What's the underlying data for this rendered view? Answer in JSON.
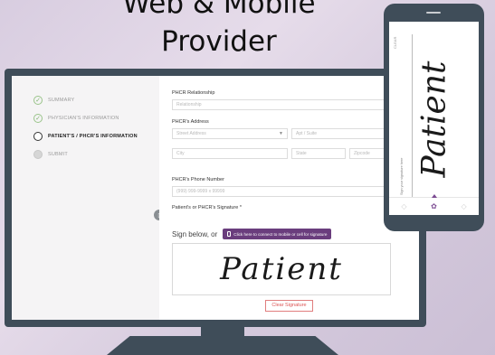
{
  "headline": {
    "line1": "Web & Mobile",
    "line2": "Provider"
  },
  "sidebar": {
    "steps": [
      {
        "label": "SUMMARY",
        "state": "done"
      },
      {
        "label": "PHYSICIAN'S INFORMATION",
        "state": "done"
      },
      {
        "label": "PATIENT'S / PHCR'S INFORMATION",
        "state": "active"
      },
      {
        "label": "SUBMIT",
        "state": "pending"
      }
    ],
    "checkmark": "✓"
  },
  "form": {
    "relationship_label": "PHCR Relationship",
    "relationship_placeholder": "Relationship",
    "address_label": "PHCR's Address",
    "street_placeholder": "Street Address",
    "apt_placeholder": "Apt / Suite",
    "city_placeholder": "City",
    "state_placeholder": "State",
    "zip_placeholder": "Zipcode",
    "phone_label": "PHCR's Phone Number",
    "phone_placeholder": "(999) 999-9999 x 99999",
    "signature_label": "Patient's or PHCR's Signature *",
    "sign_below": "Sign below, or",
    "mobile_button": "Click here to connect to mobile or cell for signature",
    "signature_value": "Patient",
    "clear_button": "Clear Signature",
    "step_marker": "▯"
  },
  "phone": {
    "signature_value": "Patient",
    "clear_label": "CLEAR",
    "hint": "Sign your signature here"
  },
  "colors": {
    "device": "#3f4d59",
    "accent": "#6a3d7d",
    "done_check": "#7eb26e",
    "clear": "#dd5555"
  }
}
